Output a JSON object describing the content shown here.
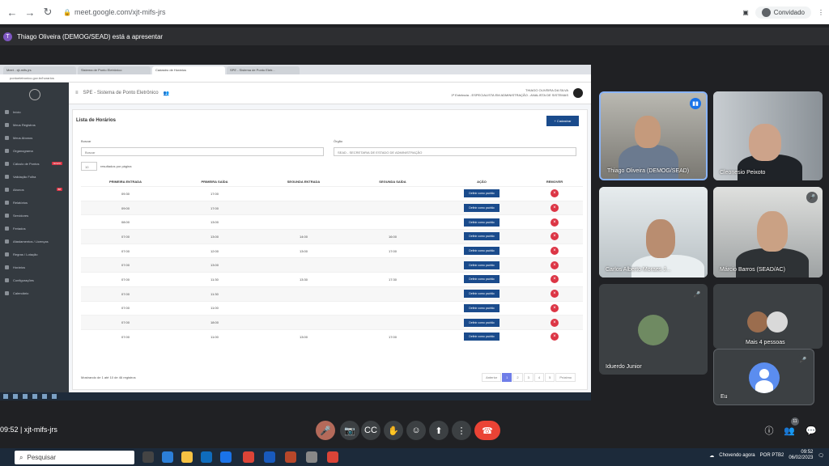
{
  "browser": {
    "url": "meet.google.com/xjt-mifs-jrs",
    "profile_label": "Convidado"
  },
  "presenter_bar": {
    "avatar_letter": "T",
    "text": "Thiago Oliveira (DEMOG/SEAD) está a apresentar"
  },
  "shared_screen": {
    "tabs": [
      "Meet - xjt-mifs-jrs",
      "Sistema de Ponto Eletrônico",
      "Cadastro de Horários",
      "SPE - Sistema de Ponto Eletr..."
    ],
    "url": "pontoeletronico.gov.br/horarios",
    "app_title": "SPE - Sistema de Ponto Eletrônico",
    "user_name": "THIAGO OLIVEIRA DA SILVA",
    "user_role": "1ª Entrância - ESPECIALISTA EM ADMINISTRAÇÃO - ANALISTA DE SISTEMAS",
    "sidebar": [
      {
        "label": "Início",
        "badge": ""
      },
      {
        "label": "Meus Registros",
        "badge": ""
      },
      {
        "label": "Meus Abonos",
        "badge": ""
      },
      {
        "label": "Organograma",
        "badge": ""
      },
      {
        "label": "Cálculo de Pontos",
        "badge": "NOVO"
      },
      {
        "label": "Validação Folha",
        "badge": ""
      },
      {
        "label": "Abonos",
        "badge": "88"
      },
      {
        "label": "Relatórios",
        "badge": ""
      },
      {
        "label": "Servidores",
        "badge": ""
      },
      {
        "label": "Feriados",
        "badge": ""
      },
      {
        "label": "Afastamentos / Licenças",
        "badge": ""
      },
      {
        "label": "Regras / Lotação",
        "badge": ""
      },
      {
        "label": "Horários",
        "badge": ""
      },
      {
        "label": "Configurações",
        "badge": ""
      },
      {
        "label": "Calendário",
        "badge": ""
      }
    ],
    "card_title": "Lista de Horários",
    "new_button": "+ Cadastrar",
    "search_label": "Buscar",
    "search_value": "Buscar",
    "org_label": "Órgão",
    "org_value": "SEAD - SECRETARIA DE ESTADO DE ADMINISTRAÇÃO",
    "page_size": "10",
    "page_size_label": "resultados por página",
    "columns": [
      "PRIMEIRA ENTRADA",
      "PRIMEIRA SAÍDA",
      "SEGUNDA ENTRADA",
      "SEGUNDA SAÍDA",
      "AÇÃO",
      "REMOVER"
    ],
    "rows": [
      {
        "e1": "09:30",
        "s1": "17:00",
        "e2": "",
        "s2": ""
      },
      {
        "e1": "09:00",
        "s1": "17:00",
        "e2": "",
        "s2": ""
      },
      {
        "e1": "08:00",
        "s1": "13:00",
        "e2": "",
        "s2": ""
      },
      {
        "e1": "07:00",
        "s1": "13:00",
        "e2": "14:00",
        "s2": "16:00"
      },
      {
        "e1": "07:00",
        "s1": "12:00",
        "e2": "13:00",
        "s2": "17:00"
      },
      {
        "e1": "07:00",
        "s1": "13:00",
        "e2": "",
        "s2": ""
      },
      {
        "e1": "07:00",
        "s1": "11:30",
        "e2": "13:30",
        "s2": "17:30"
      },
      {
        "e1": "07:00",
        "s1": "11:30",
        "e2": "",
        "s2": ""
      },
      {
        "e1": "07:00",
        "s1": "11:00",
        "e2": "",
        "s2": ""
      },
      {
        "e1": "07:00",
        "s1": "18:00",
        "e2": "",
        "s2": ""
      },
      {
        "e1": "07:00",
        "s1": "11:00",
        "e2": "13:00",
        "s2": "17:00"
      }
    ],
    "action_label": "Definir como padrão",
    "remove_icon": "×",
    "footer": "Mostrando de 1 até 10 de 46 registros",
    "pagination": [
      "Anterior",
      "1",
      "2",
      "3",
      "4",
      "5",
      "Próximo"
    ]
  },
  "participants": [
    {
      "name": "Thiago Oliveira (DEMOG/SEAD)",
      "presenting": true
    },
    {
      "name": "Cleonesio Peixoto"
    },
    {
      "name": "Carlos Alberto Moraes J..."
    },
    {
      "name": "Márcio Barros (SEAD/AC)"
    },
    {
      "name": "Iduerdo Junior"
    },
    {
      "name": "Mais 4 pessoas"
    },
    {
      "name": "Eu"
    }
  ],
  "meeting": {
    "time": "09:52",
    "code": "xjt-mifs-jrs",
    "participant_count": "11"
  },
  "taskbar": {
    "search_placeholder": "Pesquisar",
    "weather": "Chovendo agora",
    "lang": "POR PTB2",
    "clock_time": "09:52",
    "clock_date": "06/02/2023"
  }
}
